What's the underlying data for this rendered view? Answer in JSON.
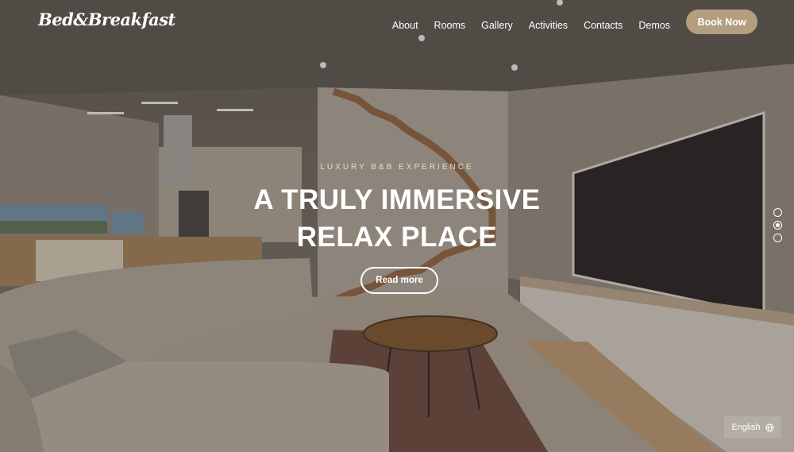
{
  "brand": {
    "logo": "Bed&Breakfast"
  },
  "nav": {
    "items": [
      "About",
      "Rooms",
      "Gallery",
      "Activities",
      "Contacts",
      "Demos"
    ],
    "cta": "Book Now"
  },
  "hero": {
    "eyebrow": "LUXURY B&B EXPERIENCE",
    "title_line1": "A TRULY IMMERSIVE",
    "title_line2": "RELAX PLACE",
    "button": "Read more",
    "slides": 3,
    "active_slide": 2
  },
  "footer": {
    "language": "English"
  },
  "colors": {
    "accent": "#b39f7f",
    "text": "#ffffff"
  }
}
